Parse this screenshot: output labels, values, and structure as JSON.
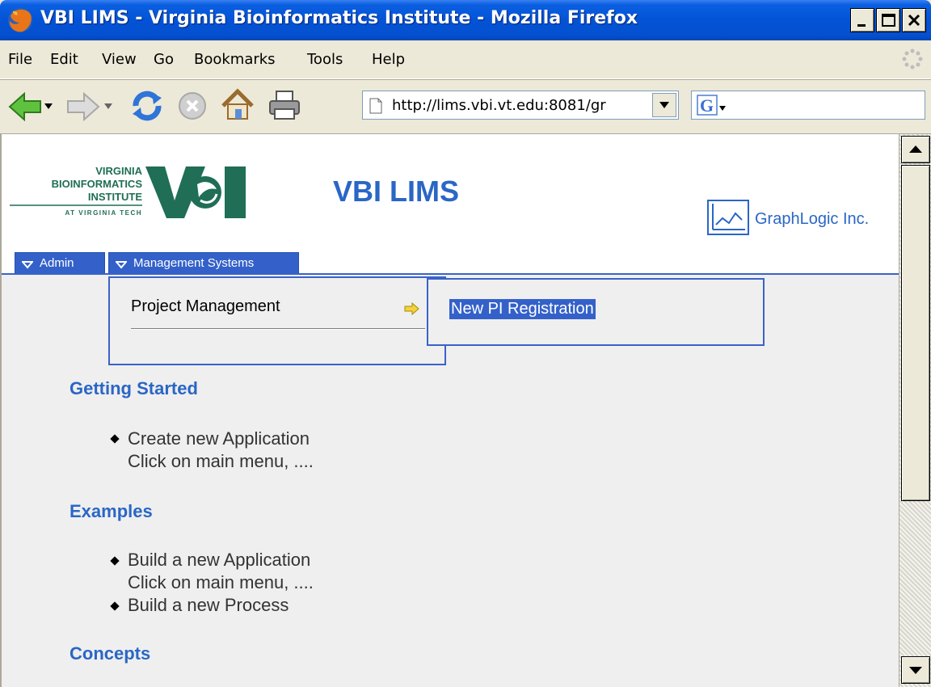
{
  "window": {
    "title": "VBI LIMS - Virginia Bioinformatics Institute - Mozilla Firefox"
  },
  "menubar": {
    "items": [
      {
        "label": "File"
      },
      {
        "label": "Edit"
      },
      {
        "label": "View"
      },
      {
        "label": "Go"
      },
      {
        "label": "Bookmarks"
      },
      {
        "label": "Tools"
      },
      {
        "label": "Help"
      }
    ]
  },
  "toolbar": {
    "url": "http://lims.vbi.vt.edu:8081/gr",
    "search_value": ""
  },
  "header": {
    "logo_lines": [
      "VIRGINIA",
      "BIOINFORMATICS",
      "INSTITUTE",
      "AT VIRGINIA TECH"
    ],
    "logo_mark": "VBI",
    "title": "VBI LIMS",
    "company": "GraphLogic Inc."
  },
  "nav": {
    "admin_label": "Admin",
    "mgmt_label": "Management Systems"
  },
  "dropdown": {
    "item_label": "Project Management",
    "submenu_item_label": "New PI Registration"
  },
  "content": {
    "sections": [
      {
        "heading": "Getting Started",
        "bullets": [
          {
            "text": "Create new Application",
            "subtext": "Click on main menu, ...."
          }
        ]
      },
      {
        "heading": "Examples",
        "bullets": [
          {
            "text": "Build a new Application",
            "subtext": "Click on main menu, ...."
          },
          {
            "text": "Build a new Process",
            "subtext": ""
          }
        ]
      },
      {
        "heading": "Concepts",
        "bullets": []
      }
    ]
  },
  "colors": {
    "title_bar": "#0453d6",
    "accent_blue": "#2a66c6",
    "nav_blue": "#3461c9",
    "logo_green": "#1f6e55"
  },
  "icons": {
    "back": "back-arrow-icon",
    "forward": "forward-arrow-icon",
    "reload": "reload-icon",
    "stop": "stop-icon",
    "home": "home-icon",
    "print": "print-icon"
  }
}
